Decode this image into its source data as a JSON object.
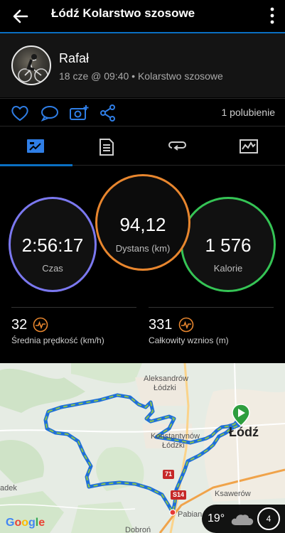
{
  "appbar": {
    "title": "Łódź Kolarstwo szosowe",
    "back_icon": "back-arrow-icon",
    "menu_icon": "more-vert-icon"
  },
  "colors": {
    "accent": "#0a6fc2",
    "time_ring": "#7b78f0",
    "distance_ring": "#e8862e",
    "calories_ring": "#35c455",
    "route_blue": "#1e6fd9",
    "route_green": "#8bc34a"
  },
  "activity": {
    "user": "Rafał",
    "subtitle": "18 cze @ 09:40 • Kolarstwo szosowe",
    "likes": "1 polubienie"
  },
  "actions": [
    "heart-icon",
    "comment-icon",
    "add-photo-icon",
    "share-icon"
  ],
  "tabs": [
    "stats-tab-icon",
    "details-tab-icon",
    "laps-tab-icon",
    "charts-tab-icon"
  ],
  "stats": {
    "time": {
      "value": "2:56:17",
      "label": "Czas"
    },
    "distance": {
      "value": "94,12",
      "label": "Dystans (km)"
    },
    "calories": {
      "value": "1 576",
      "label": "Kalorie"
    },
    "avg_speed": {
      "value": "32",
      "label": "Średnia prędkość (km/h)"
    },
    "elevation": {
      "value": "331",
      "label": "Całkowity wznios (m)"
    }
  },
  "map": {
    "labels": {
      "aleksandrow1": "Aleksandrów",
      "aleksandrow2": "Łódzki",
      "konstantynow1": "Konstantynów",
      "konstantynow2": "Łódzki",
      "lodz": "Łódź",
      "ksawerow": "Ksawerów",
      "pabianice": "Pabian",
      "dobron": "Dobroń",
      "adek": "adek"
    },
    "roads": {
      "r71": "71",
      "s14": "S14"
    },
    "google": "Google",
    "weather": {
      "temp": "19°",
      "wind": "4"
    }
  }
}
